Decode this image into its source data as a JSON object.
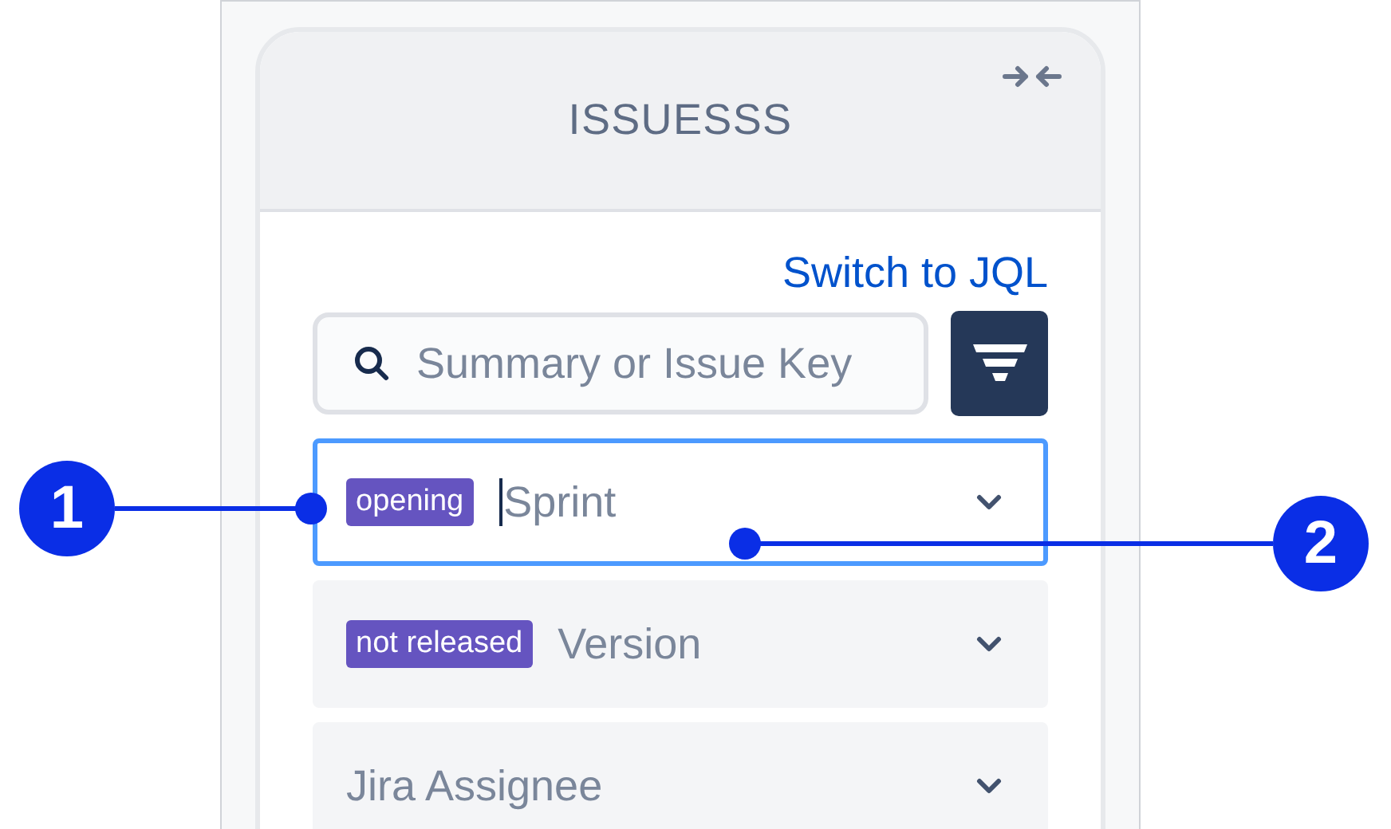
{
  "panel": {
    "title": "ISSUESSS"
  },
  "switch_link": "Switch to JQL",
  "search": {
    "placeholder": "Summary or Issue Key"
  },
  "dropdowns": [
    {
      "tag": "opening",
      "placeholder": "Sprint",
      "focused": true
    },
    {
      "tag": "not released",
      "placeholder": "Version",
      "focused": false
    },
    {
      "placeholder": "Jira Assignee",
      "focused": false
    }
  ],
  "callouts": [
    {
      "label": "1"
    },
    {
      "label": "2"
    }
  ]
}
